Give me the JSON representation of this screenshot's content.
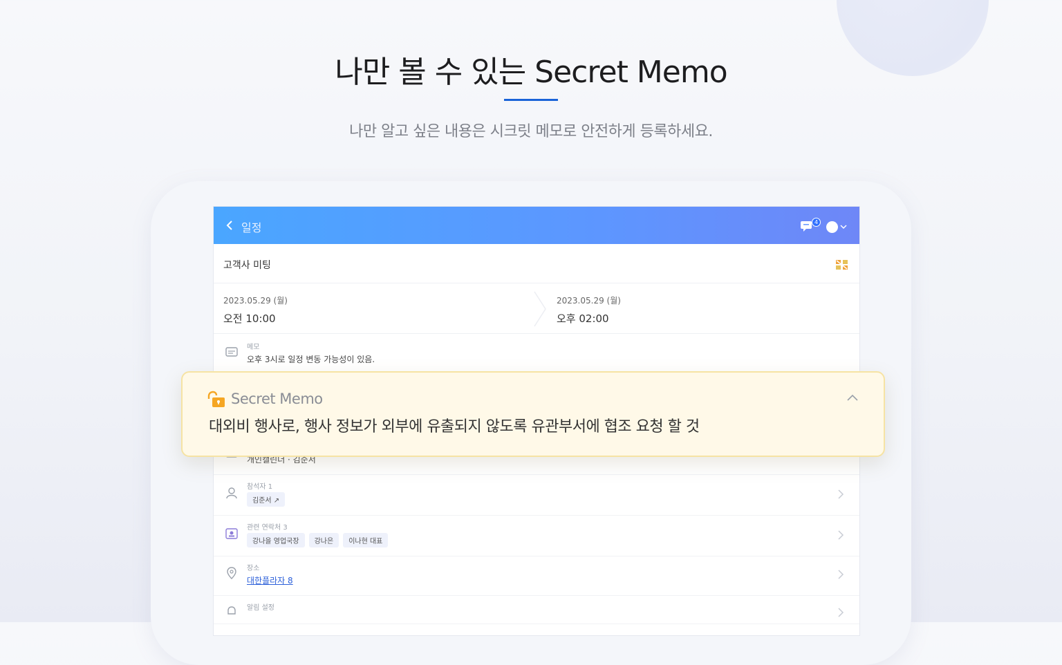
{
  "hero": {
    "title": "나만 볼 수 있는 Secret Memo",
    "subtitle": "나만 알고 싶은 내용은 시크릿 메모로 안전하게 등록하세요."
  },
  "app": {
    "header": {
      "back_label": "일정",
      "chat_badge": "4"
    },
    "event": {
      "title": "고객사 미팅",
      "start_date": "2023.05.29 (월)",
      "start_time": "오전 10:00",
      "end_date": "2023.05.29 (월)",
      "end_time": "오후 02:00"
    },
    "memo_row": {
      "label": "메모",
      "value": "오후 3시로 일정 변동 가능성이 있음."
    },
    "calendar_row": {
      "value": "개인캘린더 · 김준서"
    },
    "attendees_row": {
      "label": "참석자 1",
      "chips": [
        "김준서 ↗"
      ]
    },
    "related_row": {
      "label": "관련 연락처 3",
      "chips": [
        "강나을 영업국장",
        "강나은",
        "이나현 대표"
      ]
    },
    "place_row": {
      "label": "장소",
      "value": "대한플라자 8"
    },
    "alert_row": {
      "label": "알림 설정"
    }
  },
  "secret_memo": {
    "title": "Secret Memo",
    "text": "대외비 행사로, 행사 정보가 외부에 유출되지 않도록 유관부서에 협조 요청 할 것"
  },
  "colors": {
    "accent": "#1a63d8",
    "appbar_start": "#4aa6ff",
    "appbar_end": "#6e87f7",
    "memo_bg": "#fff9e8",
    "memo_border": "#f6e3a3",
    "lock_orange": "#f5a623"
  }
}
